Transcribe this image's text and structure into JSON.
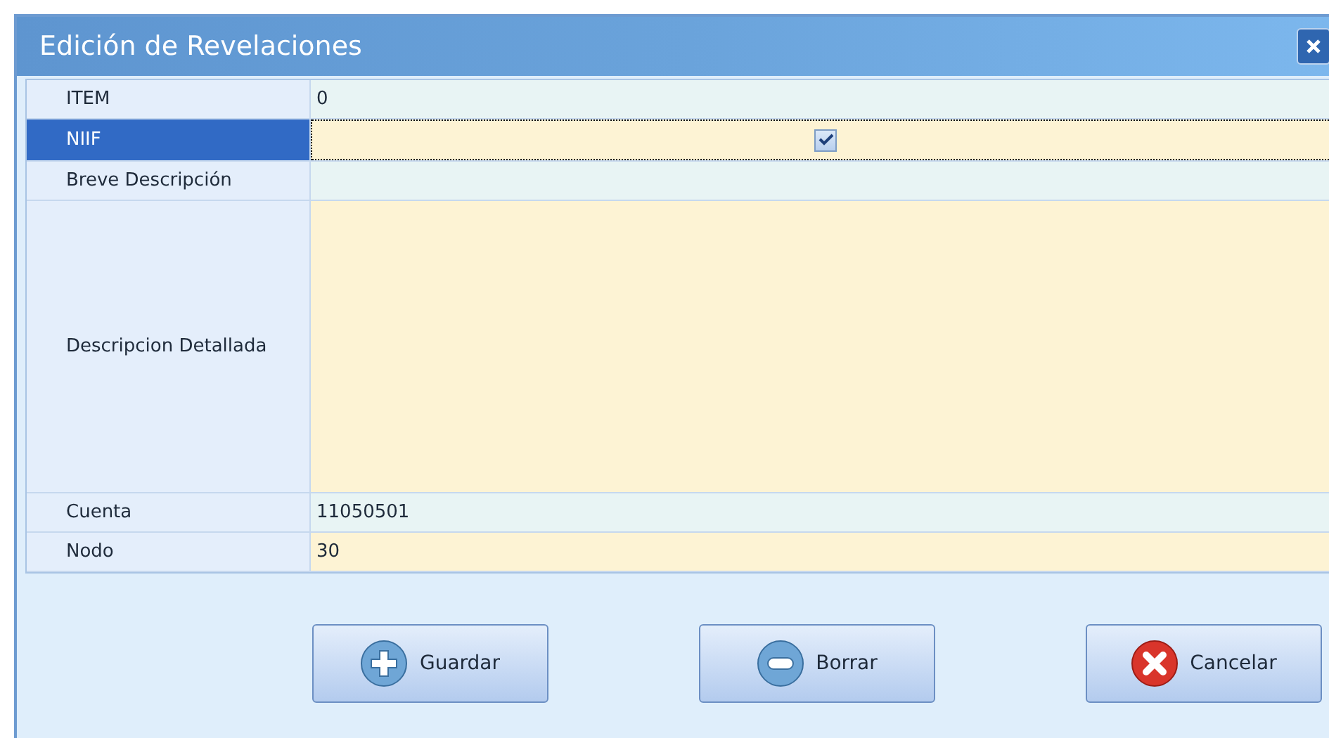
{
  "window": {
    "title": "Edición de Revelaciones"
  },
  "rows": [
    {
      "label": "ITEM",
      "kind": "text",
      "value": "0",
      "selected": false
    },
    {
      "label": "NIIF",
      "kind": "checkbox",
      "checked": true,
      "selected": true
    },
    {
      "label": "Breve Descripción",
      "kind": "text",
      "selected": false
    },
    {
      "label": "Descripcion Detallada",
      "kind": "multiline",
      "selected": false
    },
    {
      "label": "Cuenta",
      "kind": "text",
      "value": "11050501",
      "selected": false
    },
    {
      "label": "Nodo",
      "kind": "text",
      "value": "30",
      "selected": false
    }
  ],
  "buttons": [
    {
      "label": "Guardar",
      "kind": "add"
    },
    {
      "label": "Borrar",
      "kind": "remove"
    },
    {
      "label": "Cancelar",
      "kind": "cancel"
    }
  ]
}
